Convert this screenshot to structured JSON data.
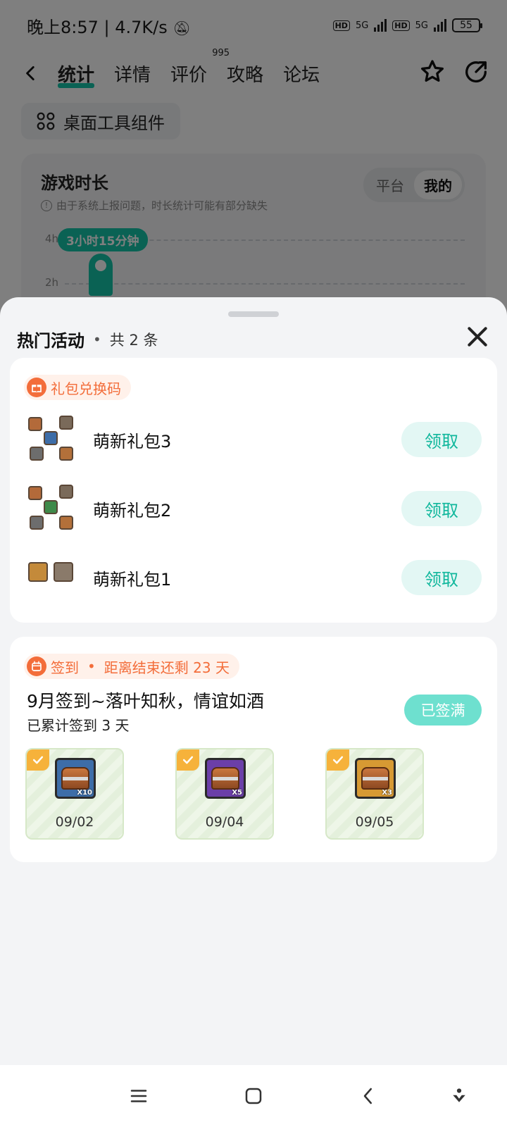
{
  "status": {
    "time": "晚上8:57",
    "speed": "4.7K/s",
    "network_label": "5G",
    "hd_label": "HD",
    "battery": "55"
  },
  "nav": {
    "tabs": [
      {
        "label": "统计"
      },
      {
        "label": "详情"
      },
      {
        "label": "评价",
        "badge": "995"
      },
      {
        "label": "攻略"
      },
      {
        "label": "论坛"
      }
    ]
  },
  "widget_chip": {
    "label": "桌面工具组件"
  },
  "stats": {
    "title": "游戏时长",
    "note": "由于系统上报问题，时长统计可能有部分缺失",
    "segments": [
      "平台",
      "我的"
    ],
    "axis": [
      "4h",
      "2h"
    ],
    "bubble": "3小时15分钟"
  },
  "sheet": {
    "title": "热门活动",
    "count": "共 2 条",
    "gift_section": {
      "tag": "礼包兑换码",
      "items": [
        {
          "name": "萌新礼包3",
          "action": "领取"
        },
        {
          "name": "萌新礼包2",
          "action": "领取"
        },
        {
          "name": "萌新礼包1",
          "action": "领取"
        }
      ]
    },
    "checkin_section": {
      "tag": "签到",
      "remaining": "距离结束还剩 23 天",
      "title": "9月签到~落叶知秋，情谊如酒",
      "subtitle": "已累计签到 3 天",
      "status_button": "已签满",
      "days": [
        {
          "date": "09/02",
          "qty": "X10",
          "color": "#3d6da8"
        },
        {
          "date": "09/04",
          "qty": "X5",
          "color": "#6b3fa8"
        },
        {
          "date": "09/05",
          "qty": "X3",
          "color": "#d79a33"
        }
      ]
    }
  }
}
